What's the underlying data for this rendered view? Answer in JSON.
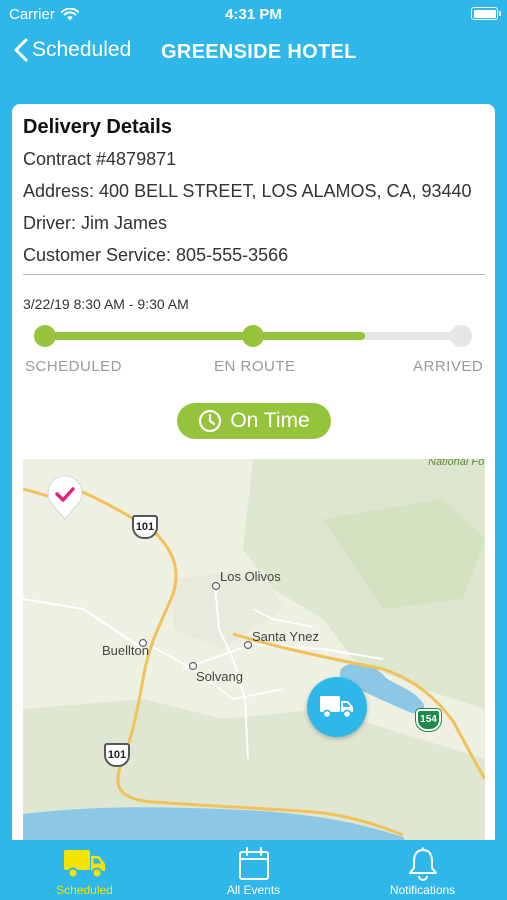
{
  "status_bar": {
    "carrier": "Carrier",
    "time": "4:31 PM"
  },
  "nav": {
    "back_label": "Scheduled",
    "title": "GREENSIDE HOTEL"
  },
  "delivery": {
    "heading": "Delivery Details",
    "contract": "Contract #4879871",
    "address": "Address: 400 BELL STREET, LOS ALAMOS, CA, 93440",
    "driver": "Driver: Jim James",
    "customer_service": "Customer Service: 805-555-3566",
    "window": "3/22/19 8:30 AM - 9:30 AM",
    "progress_fraction": 0.77,
    "steps": [
      {
        "label": "SCHEDULED",
        "done": true
      },
      {
        "label": "EN ROUTE",
        "done": true
      },
      {
        "label": "ARRIVED",
        "done": false
      }
    ],
    "status_badge": "On Time"
  },
  "map": {
    "places": [
      "Los Olivos",
      "Santa Ynez",
      "Buellton",
      "Solvang"
    ],
    "shields": [
      "101",
      "101",
      "154"
    ],
    "forest_label": "National Fo"
  },
  "tabs": [
    {
      "label": "Scheduled",
      "icon": "truck-icon",
      "active": true
    },
    {
      "label": "All Events",
      "icon": "calendar-icon",
      "active": false
    },
    {
      "label": "Notifications",
      "icon": "bell-icon",
      "active": false
    }
  ],
  "colors": {
    "brand": "#2fb7ea",
    "success": "#95c43c",
    "active_tab": "#f5e400",
    "pin_check": "#e0237f"
  }
}
